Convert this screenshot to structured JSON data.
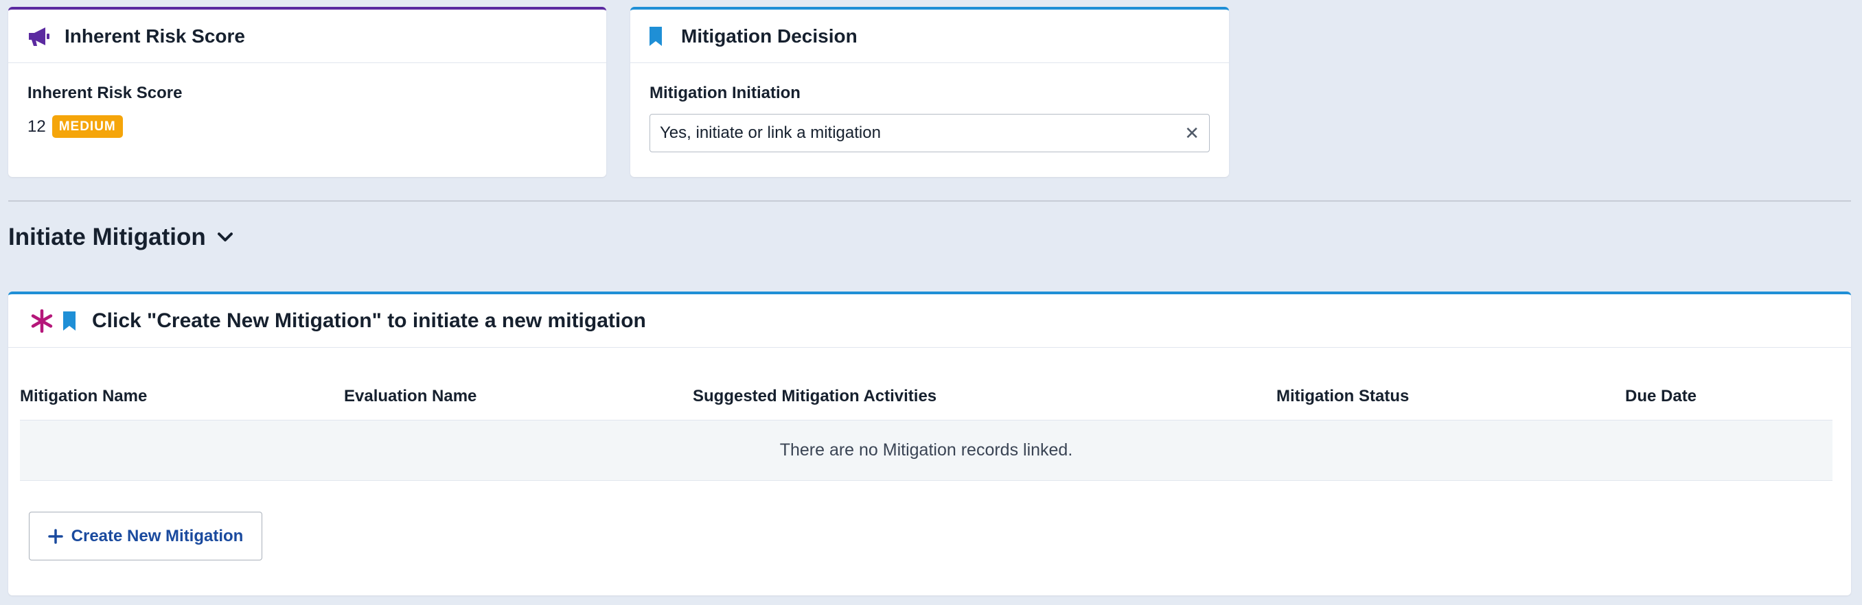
{
  "risk_card": {
    "title": "Inherent Risk Score",
    "icon": "megaphone-icon",
    "field_label": "Inherent Risk Score",
    "score": "12",
    "level": "MEDIUM"
  },
  "decision_card": {
    "title": "Mitigation Decision",
    "icon": "bookmark-icon",
    "field_label": "Mitigation Initiation",
    "selected_value": "Yes, initiate or link a mitigation"
  },
  "section": {
    "title": "Initiate Mitigation"
  },
  "mitigation_card": {
    "title": "Click \"Create New Mitigation\" to initiate a new mitigation",
    "columns": [
      "Mitigation Name",
      "Evaluation Name",
      "Suggested Mitigation Activities",
      "Mitigation Status",
      "Due Date"
    ],
    "empty_message": "There are no Mitigation records linked.",
    "create_button": "Create New Mitigation"
  },
  "colors": {
    "purple_accent": "#5b2aa0",
    "blue_accent": "#1f8fd6",
    "required_asterisk": "#b5177a",
    "medium_badge": "#f5a50a",
    "link_blue": "#1a4a9e"
  }
}
